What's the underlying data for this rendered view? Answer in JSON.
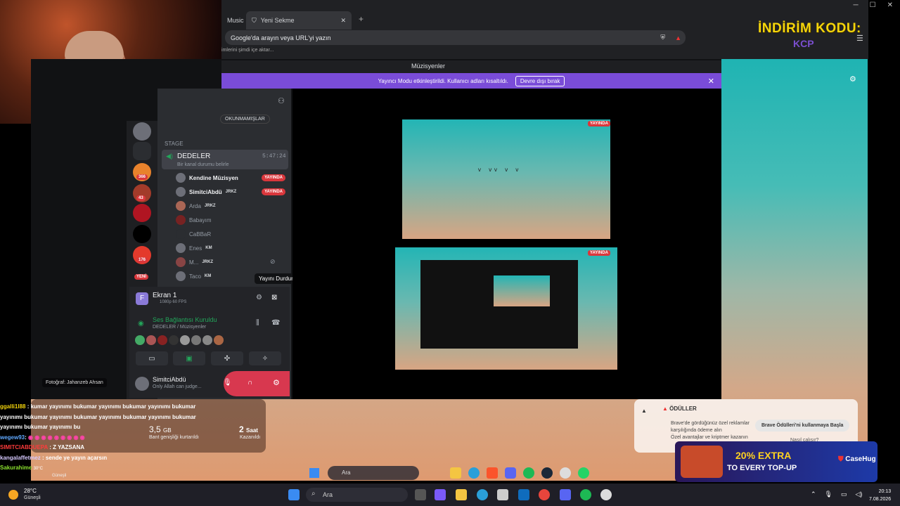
{
  "browser": {
    "tab_music": "Music",
    "tab_new": "Yeni Sekme",
    "url_placeholder": "Google'da arayın veya URL'yi yazın",
    "import_text": "imlerini şimdi içe aktar..."
  },
  "promo": {
    "code_label": "İNDİRİM KODU:",
    "code": "KCP"
  },
  "discord": {
    "window_title": "Müzisyenler",
    "streamer_mode": "Yayıncı Modu etkinleştirildi. Kullanıcı adları kısaltıldı.",
    "streamer_btn": "Devre dışı bırak",
    "unread": "OKUNMAMIŞLAR",
    "server_badges": [
      "366",
      "43",
      "176"
    ],
    "new_badge": "YENİ",
    "stage_header": "STAGE",
    "channel": {
      "name": "DEDELER",
      "time": "5:47:24",
      "sub": "Bir kanal durumu belirle"
    },
    "members": [
      {
        "name": "Kendine Müzisyen",
        "tag": "",
        "live": "YAYINDA"
      },
      {
        "name": "SimitciAbdü",
        "tag": "JRKZ",
        "live": "YAYINDA"
      },
      {
        "name": "Arda",
        "tag": "JRKZ",
        "live": ""
      },
      {
        "name": "Babayım",
        "tag": "",
        "live": ""
      },
      {
        "name": "CaBBaR",
        "tag": "",
        "live": ""
      },
      {
        "name": "Enes",
        "tag": "KM",
        "live": ""
      },
      {
        "name": "M...",
        "tag": "JRKZ",
        "live": ""
      },
      {
        "name": "Taco",
        "tag": "KM",
        "live": ""
      }
    ],
    "tooltip": "Yayını Durdur",
    "screen": {
      "name": "Ekran 1",
      "quality": "1080p 60 FPS"
    },
    "voice": {
      "status": "Ses Bağlantısı Kuruldu",
      "channel": "DEDELER / Müzisyenler"
    },
    "user": {
      "name": "SimitciAbdü",
      "status": "Only Allah can judge..."
    },
    "live_label": "YAYINDA"
  },
  "overlay": {
    "photo_credit": "Fotoğraf: Jahanzeb Ahsan",
    "savings_value": "3,5",
    "savings_unit": "GB",
    "savings_label": "Bant genişliği kurtarıldı",
    "time_value": "2",
    "time_unit": "Saat",
    "time_label": "Kazanıldı",
    "rewards_title": "ÖDÜLLER",
    "rewards_line1": "Brave'de gördüğünüz özel reklamlar",
    "rewards_line2": "karşılığında ödeme alın",
    "rewards_line3": "Özel avantajlar ve kriptmer kazanın",
    "rewards_btn": "Brave Ödülleri'ni kullanmaya Başla",
    "rewards_link": "Nasıl çalışır?"
  },
  "chat": [
    {
      "user": "ggalli1l88",
      "msg": ": kumar yayınımı bukumar yayınımı bukumar yayınımı bukumar",
      "color": "#f4d50b"
    },
    {
      "user": "",
      "msg": "yayınımı bukumar yayınımı bukumar yayınımı bukumar yayınımı bukumar",
      "color": "#fff"
    },
    {
      "user": "",
      "msg": "yayınımı bukumar yayınımı bu",
      "color": "#fff"
    },
    {
      "user": "wegew93",
      "msg": ":",
      "color": "#5fa8ff"
    },
    {
      "user": "SIMITCIABDUEPA",
      "msg": ": Z YAZSANA",
      "color": "#ff3b3b"
    },
    {
      "user": "kangalaffetmez",
      "msg": ": sende ye yayın açarsın",
      "color": "#d6c9ff"
    },
    {
      "user": "Sakurahime",
      "msg": "",
      "color": "#8be02e"
    }
  ],
  "inner": {
    "search": "Ara",
    "weather_temp": "30°C",
    "weather_desc": "Güneşli",
    "date": "7.08.2026"
  },
  "ad": {
    "line1": "20% EXTRA",
    "line2": "TO EVERY TOP-UP",
    "brand": "CaseHug"
  },
  "taskbar": {
    "weather_temp": "28°C",
    "weather_desc": "Güneşli",
    "search": "Ara",
    "time": "20:13",
    "date": "7.08.2026"
  },
  "colors": {
    "accent": "#7a4cd8",
    "live": "#da373c",
    "voice_green": "#23a55a"
  }
}
